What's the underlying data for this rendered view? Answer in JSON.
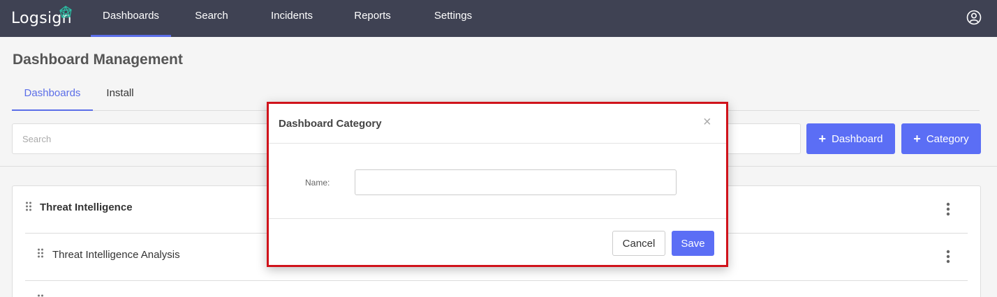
{
  "brand": {
    "name": "Logsign",
    "accent": "#5b6ee8",
    "nav_bg": "#3f4253",
    "highlight": "#d0131b"
  },
  "nav": {
    "items": [
      {
        "label": "Dashboards",
        "active": true
      },
      {
        "label": "Search",
        "active": false
      },
      {
        "label": "Incidents",
        "active": false
      },
      {
        "label": "Reports",
        "active": false
      },
      {
        "label": "Settings",
        "active": false
      }
    ],
    "user_icon": "user-circle-icon"
  },
  "page": {
    "title": "Dashboard Management",
    "tabs": [
      {
        "label": "Dashboards",
        "active": true
      },
      {
        "label": "Install",
        "active": false
      }
    ],
    "search": {
      "placeholder": "Search",
      "value": ""
    },
    "add_dashboard_label": "Dashboard",
    "add_category_label": "Category"
  },
  "list": {
    "rows": [
      {
        "title": "Threat Intelligence",
        "type": "category"
      },
      {
        "title": "Threat Intelligence Analysis",
        "type": "dashboard"
      }
    ]
  },
  "modal": {
    "title": "Dashboard Category",
    "name_label": "Name:",
    "name_value": "",
    "cancel_label": "Cancel",
    "save_label": "Save"
  }
}
